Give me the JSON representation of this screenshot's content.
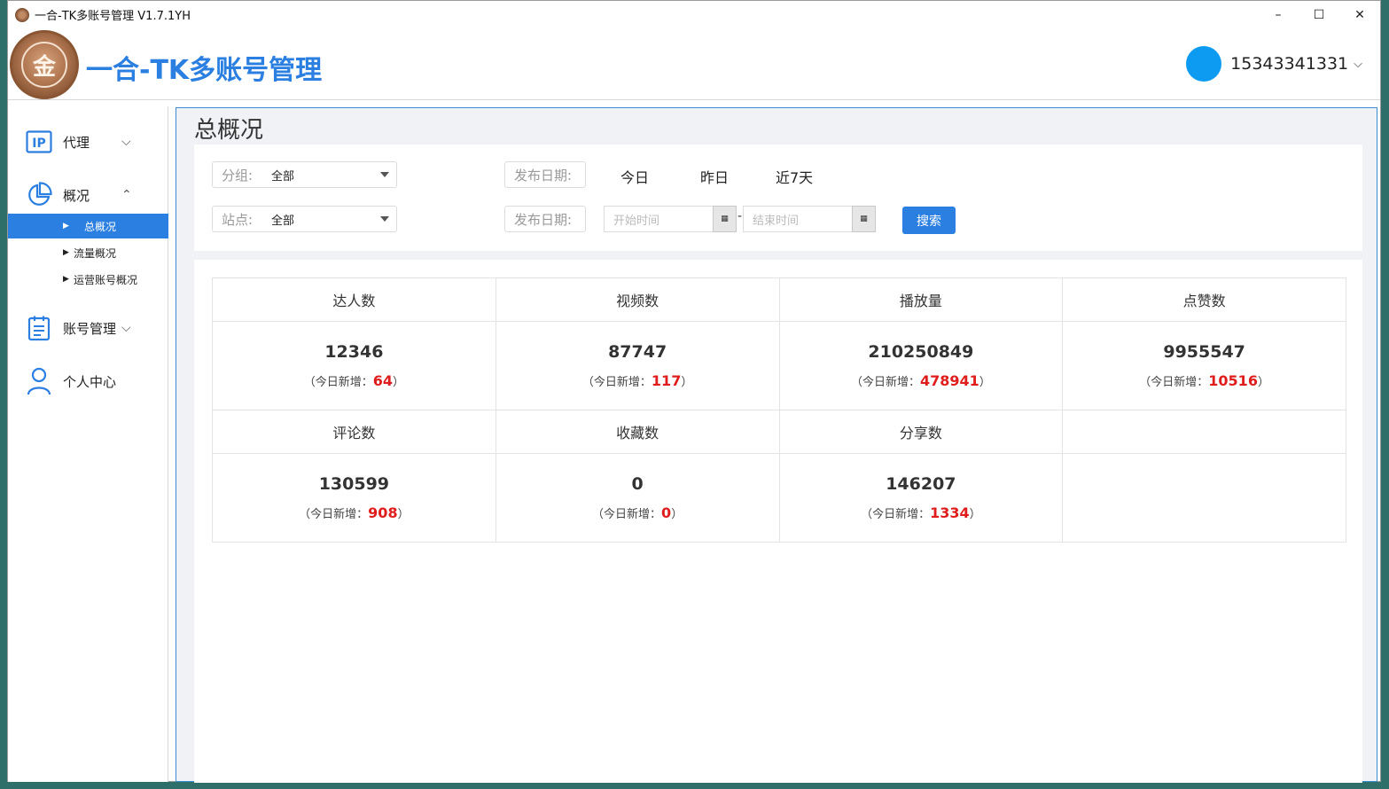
{
  "window": {
    "title": "一合-TK多账号管理 V1.7.1YH",
    "controls": {
      "minimize": "–",
      "maximize": "☐",
      "close": "✕"
    }
  },
  "header": {
    "logo_text": "金",
    "brand": "一合-TK多账号管理",
    "username": "15343341331",
    "chevron": "⌵"
  },
  "sidebar": {
    "items": [
      {
        "label": "代理",
        "icon": "ip-icon",
        "arrow": "⌵"
      },
      {
        "label": "概况",
        "icon": "pie-chart-icon",
        "arrow": "⌃"
      },
      {
        "label": "账号管理",
        "icon": "clipboard-icon",
        "arrow": "⌵"
      },
      {
        "label": "个人中心",
        "icon": "user-icon"
      }
    ],
    "sub_items": [
      "总概况",
      "流量概况",
      "运营账号概况"
    ],
    "active_sub": "总概况"
  },
  "page": {
    "title": "总概况"
  },
  "filters": {
    "group_label": "分组:",
    "group_value": "全部",
    "site_label": "站点:",
    "site_value": "全部",
    "date_label": "发布日期:",
    "quick_dates": [
      "今日",
      "昨日",
      "近7天"
    ],
    "start_placeholder": "开始时间",
    "end_placeholder": "结束时间",
    "dash": "-",
    "search": "搜索"
  },
  "stats": {
    "increase_prefix": "（今日新增：",
    "increase_suffix": "）",
    "rows": [
      [
        {
          "label": "达人数",
          "value": "12346",
          "increase": "64"
        },
        {
          "label": "视频数",
          "value": "87747",
          "increase": "117"
        },
        {
          "label": "播放量",
          "value": "210250849",
          "increase": "478941"
        },
        {
          "label": "点赞数",
          "value": "9955547",
          "increase": "10516"
        }
      ],
      [
        {
          "label": "评论数",
          "value": "130599",
          "increase": "908"
        },
        {
          "label": "收藏数",
          "value": "0",
          "increase": "0"
        },
        {
          "label": "分享数",
          "value": "146207",
          "increase": "1334"
        }
      ]
    ]
  },
  "colors": {
    "accent": "#2b7fe0",
    "increase": "#e01d1d",
    "avatar": "#0d9bf2"
  }
}
